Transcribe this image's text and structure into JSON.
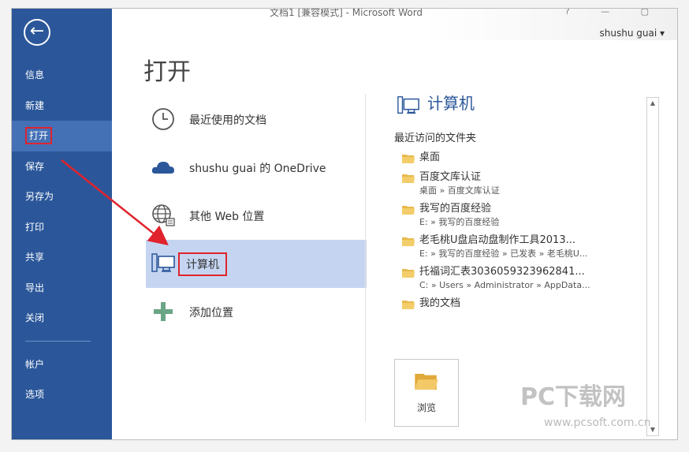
{
  "window": {
    "title": "文档1 [兼容模式] - Microsoft Word",
    "controls": "? — ▢",
    "user": "shushu guai ▾"
  },
  "sidebar": {
    "back_icon": "back-arrow-icon",
    "items": [
      {
        "label": "信息"
      },
      {
        "label": "新建"
      },
      {
        "label": "打开"
      },
      {
        "label": "保存"
      },
      {
        "label": "另存为"
      },
      {
        "label": "打印"
      },
      {
        "label": "共享"
      },
      {
        "label": "导出"
      },
      {
        "label": "关闭"
      }
    ],
    "bottom_items": [
      {
        "label": "帐户"
      },
      {
        "label": "选项"
      }
    ],
    "accent": "#2b579a",
    "active_bg": "#4470b6"
  },
  "page": {
    "title": "打开"
  },
  "places": [
    {
      "label": "最近使用的文档",
      "icon": "clock-icon"
    },
    {
      "label": "shushu guai 的 OneDrive",
      "icon": "cloud-icon"
    },
    {
      "label": "其他 Web 位置",
      "icon": "globe-icon"
    },
    {
      "label": "计算机",
      "icon": "computer-icon"
    },
    {
      "label": "添加位置",
      "icon": "plus-icon"
    }
  ],
  "right": {
    "title": "计算机",
    "subtitle": "最近访问的文件夹",
    "folders": [
      {
        "name": "桌面",
        "path": ""
      },
      {
        "name": "百度文库认证",
        "path": "桌面 » 百度文库认证"
      },
      {
        "name": "我写的百度经验",
        "path": "E: » 我写的百度经验"
      },
      {
        "name": "老毛桃U盘启动盘制作工具2013...",
        "path": "E: » 我写的百度经验 » 已发表 » 老毛桃U..."
      },
      {
        "name": "托福词汇表3036059323962841...",
        "path": "C: » Users » Administrator » AppData..."
      },
      {
        "name": "我的文档",
        "path": ""
      }
    ],
    "browse_label": "浏览"
  },
  "watermark": {
    "text": "PC下载网",
    "url": "www.pcsoft.com.cn"
  }
}
